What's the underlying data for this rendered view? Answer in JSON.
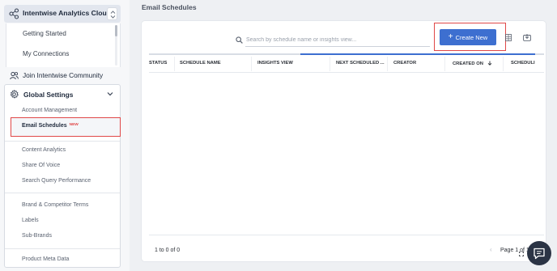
{
  "sidebar": {
    "app_title": "Intentwise Analytics Cloud",
    "subnav": [
      "Getting Started",
      "My Connections"
    ],
    "community_label": "Join Intentwise Community",
    "global_settings": {
      "label": "Global Settings",
      "items": [
        {
          "label": "Account Management"
        },
        {
          "label": "Email Schedules",
          "tag": "NEW",
          "active": true
        },
        {
          "label": "Content Analytics"
        },
        {
          "label": "Share Of Voice"
        },
        {
          "label": "Search Query Performance"
        },
        {
          "label": "Brand & Competitor Terms"
        },
        {
          "label": "Labels"
        },
        {
          "label": "Sub-Brands"
        },
        {
          "label": "Product Meta Data"
        }
      ]
    }
  },
  "main": {
    "page_title": "Email Schedules",
    "search": {
      "placeholder": "Search by schedule name or insights view...",
      "value": ""
    },
    "create_button": {
      "label": "Create New",
      "icon": "plus-icon"
    },
    "table": {
      "columns": [
        "STATUS",
        "SCHEDULE NAME",
        "INSIGHTS VIEW",
        "NEXT SCHEDULED ...",
        "CREATOR",
        "CREATED ON",
        "SCHEDULI"
      ],
      "sort_column": "CREATED ON",
      "sort_direction": "descending",
      "rows": []
    },
    "footer": {
      "count_text": "1 to 0 of 0",
      "page_text": "Page 1 of 1"
    }
  },
  "colors": {
    "accent": "#3d6fd0",
    "highlight": "#e04848",
    "chat": "#2b3445"
  }
}
